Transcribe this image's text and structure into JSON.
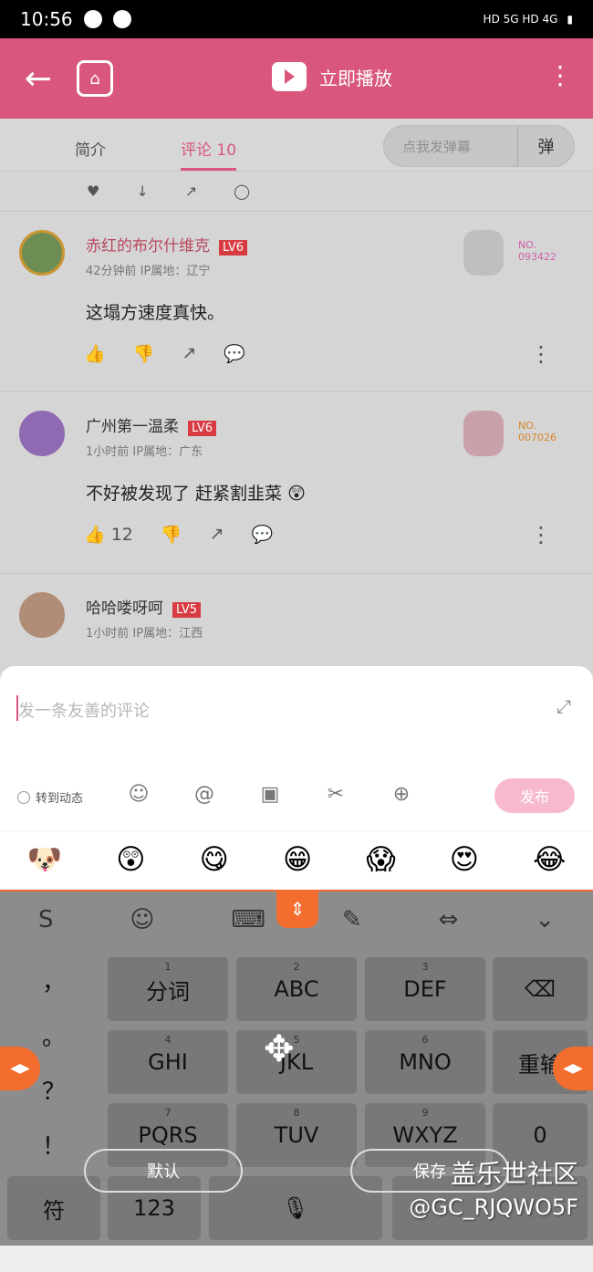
{
  "status": {
    "time": "10:56",
    "signals": "HD 5G HD 4G"
  },
  "appbar": {
    "title": "立即播放"
  },
  "tabs": {
    "intro": "简介",
    "comments": "评论 10",
    "danmaku_placeholder": "点我发弹幕",
    "danmaku_button": "弹"
  },
  "comments": [
    {
      "name": "赤红的布尔什维克",
      "level": "LV6",
      "meta": "42分钟前 IP属地：辽宁",
      "text": "这塌方速度真快。",
      "no": "NO.",
      "no_number": "093422",
      "likes": ""
    },
    {
      "name": "广州第一温柔",
      "level": "LV6",
      "meta": "1小时前 IP属地：广东",
      "text": "不好被发现了 赶紧割韭菜 😲",
      "no": "NO.",
      "no_number": "007026",
      "likes": "12"
    },
    {
      "name": "哈哈喽呀呵",
      "level": "LV5",
      "meta": "1小时前 IP属地：江西",
      "text": "",
      "no": "",
      "no_number": "",
      "likes": ""
    }
  ],
  "composer": {
    "placeholder": "发一条友善的评论",
    "repost": "转到动态",
    "publish": "发布"
  },
  "emojis": [
    "🐶",
    "😲",
    "😋",
    "😁",
    "😱",
    "😍",
    "😂"
  ],
  "keyboard": {
    "top": [
      "S",
      "☺",
      "⌨",
      "✎",
      "⇔",
      "⌄"
    ],
    "side_keys": [
      "，",
      "。",
      "？",
      "！"
    ],
    "keys": [
      {
        "num": "1",
        "label": "分词"
      },
      {
        "num": "2",
        "label": "ABC"
      },
      {
        "num": "3",
        "label": "DEF"
      },
      {
        "num": "4",
        "label": "GHI"
      },
      {
        "num": "5",
        "label": "JKL"
      },
      {
        "num": "6",
        "label": "MNO"
      },
      {
        "num": "7",
        "label": "PQRS"
      },
      {
        "num": "8",
        "label": "TUV"
      },
      {
        "num": "9",
        "label": "WXYZ"
      }
    ],
    "backspace": "⌫",
    "reenter": "重输",
    "zero": "0",
    "symbol": "符",
    "numbers": "123",
    "default_label": "默认",
    "save_label": "保存"
  },
  "watermark": {
    "title": "盖乐世社区",
    "user": "@GC_RJQWO5F"
  }
}
